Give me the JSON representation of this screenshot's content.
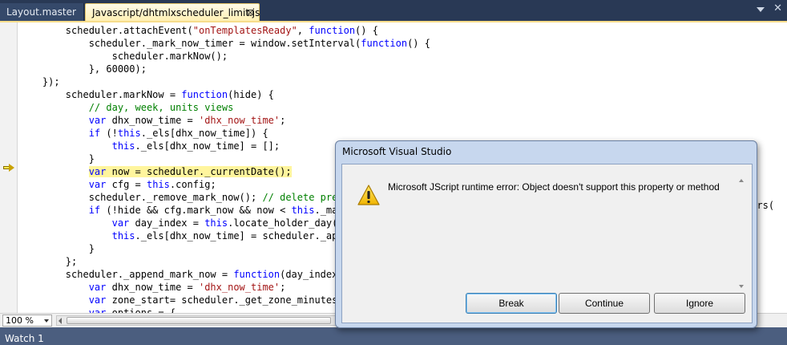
{
  "tabs": {
    "inactive_label": "Layout.master",
    "active_label": "Javascript/dhtmlxscheduler_limit.js",
    "close_glyph": "⊠"
  },
  "code_lines": [
    {
      "segs": [
        {
          "t": "        scheduler.attachEvent(",
          "c": ""
        },
        {
          "t": "\"onTemplatesReady\"",
          "c": "str"
        },
        {
          "t": ", ",
          "c": ""
        },
        {
          "t": "function",
          "c": "kw"
        },
        {
          "t": "() {",
          "c": ""
        }
      ]
    },
    {
      "segs": [
        {
          "t": "            scheduler._mark_now_timer = window.setInterval(",
          "c": ""
        },
        {
          "t": "function",
          "c": "kw"
        },
        {
          "t": "() {",
          "c": ""
        }
      ]
    },
    {
      "segs": [
        {
          "t": "                scheduler.markNow();",
          "c": ""
        }
      ]
    },
    {
      "segs": [
        {
          "t": "            }, 60000);",
          "c": ""
        }
      ]
    },
    {
      "segs": [
        {
          "t": "    });",
          "c": ""
        }
      ]
    },
    {
      "segs": [
        {
          "t": "        scheduler.markNow = ",
          "c": ""
        },
        {
          "t": "function",
          "c": "kw"
        },
        {
          "t": "(hide) {",
          "c": ""
        }
      ]
    },
    {
      "segs": [
        {
          "t": "            ",
          "c": ""
        },
        {
          "t": "// day, week, units views",
          "c": "cmt"
        }
      ]
    },
    {
      "segs": [
        {
          "t": "            ",
          "c": ""
        },
        {
          "t": "var",
          "c": "kw"
        },
        {
          "t": " dhx_now_time = ",
          "c": ""
        },
        {
          "t": "'dhx_now_time'",
          "c": "str"
        },
        {
          "t": ";",
          "c": ""
        }
      ]
    },
    {
      "segs": [
        {
          "t": "            ",
          "c": ""
        },
        {
          "t": "if",
          "c": "kw"
        },
        {
          "t": " (!",
          "c": ""
        },
        {
          "t": "this",
          "c": "kw"
        },
        {
          "t": "._els[dhx_now_time]) {",
          "c": ""
        }
      ]
    },
    {
      "segs": [
        {
          "t": "                ",
          "c": ""
        },
        {
          "t": "this",
          "c": "kw"
        },
        {
          "t": "._els[dhx_now_time] = [];",
          "c": ""
        }
      ]
    },
    {
      "segs": [
        {
          "t": "            }",
          "c": ""
        }
      ]
    },
    {
      "segs": [
        {
          "t": "            ",
          "c": ""
        },
        {
          "t": "var",
          "c": "kw hl"
        },
        {
          "t": " now = scheduler._currentDate();",
          "c": "hl"
        }
      ]
    },
    {
      "segs": [
        {
          "t": "            ",
          "c": ""
        },
        {
          "t": "var",
          "c": "kw"
        },
        {
          "t": " cfg = ",
          "c": ""
        },
        {
          "t": "this",
          "c": "kw"
        },
        {
          "t": ".config;",
          "c": ""
        }
      ]
    },
    {
      "segs": [
        {
          "t": "            scheduler._remove_mark_now(); ",
          "c": ""
        },
        {
          "t": "// delete previo",
          "c": "cmt"
        }
      ]
    },
    {
      "segs": [
        {
          "t": "            ",
          "c": ""
        },
        {
          "t": "if",
          "c": "kw"
        },
        {
          "t": " (!hide && cfg.mark_now && now < ",
          "c": ""
        },
        {
          "t": "this",
          "c": "kw"
        },
        {
          "t": "._max_d",
          "c": ""
        }
      ]
    },
    {
      "segs": [
        {
          "t": "                ",
          "c": ""
        },
        {
          "t": "var",
          "c": "kw"
        },
        {
          "t": " day_index = ",
          "c": ""
        },
        {
          "t": "this",
          "c": "kw"
        },
        {
          "t": ".locate_holder_day(now",
          "c": ""
        }
      ]
    },
    {
      "segs": [
        {
          "t": "                ",
          "c": ""
        },
        {
          "t": "this",
          "c": "kw"
        },
        {
          "t": "._els[dhx_now_time] = scheduler._appen",
          "c": ""
        }
      ]
    },
    {
      "segs": [
        {
          "t": "            }",
          "c": ""
        }
      ]
    },
    {
      "segs": [
        {
          "t": "        };",
          "c": ""
        }
      ]
    },
    {
      "segs": [
        {
          "t": "        scheduler._append_mark_now = ",
          "c": ""
        },
        {
          "t": "function",
          "c": "kw"
        },
        {
          "t": "(day_index, n",
          "c": ""
        }
      ]
    },
    {
      "segs": [
        {
          "t": "            ",
          "c": ""
        },
        {
          "t": "var",
          "c": "kw"
        },
        {
          "t": " dhx_now_time = ",
          "c": ""
        },
        {
          "t": "'dhx_now_time'",
          "c": "str"
        },
        {
          "t": ";",
          "c": ""
        }
      ]
    },
    {
      "segs": [
        {
          "t": "            ",
          "c": ""
        },
        {
          "t": "var",
          "c": "kw"
        },
        {
          "t": " zone_start= scheduler._get_zone_minutes(no",
          "c": ""
        }
      ]
    },
    {
      "segs": [
        {
          "t": "            ",
          "c": ""
        },
        {
          "t": "var",
          "c": "kw"
        },
        {
          "t": " options = {",
          "c": ""
        }
      ]
    }
  ],
  "code_right_fragment": "ours(",
  "editor_bottom": {
    "zoom_value": "100 %"
  },
  "watch_panel": {
    "title": "Watch 1"
  },
  "dialog": {
    "title": "Microsoft Visual Studio",
    "message": "Microsoft JScript runtime error: Object doesn't support this property or method",
    "icon": "warning-icon",
    "buttons": {
      "break": "Break",
      "continue": "Continue",
      "ignore": "Ignore"
    }
  }
}
